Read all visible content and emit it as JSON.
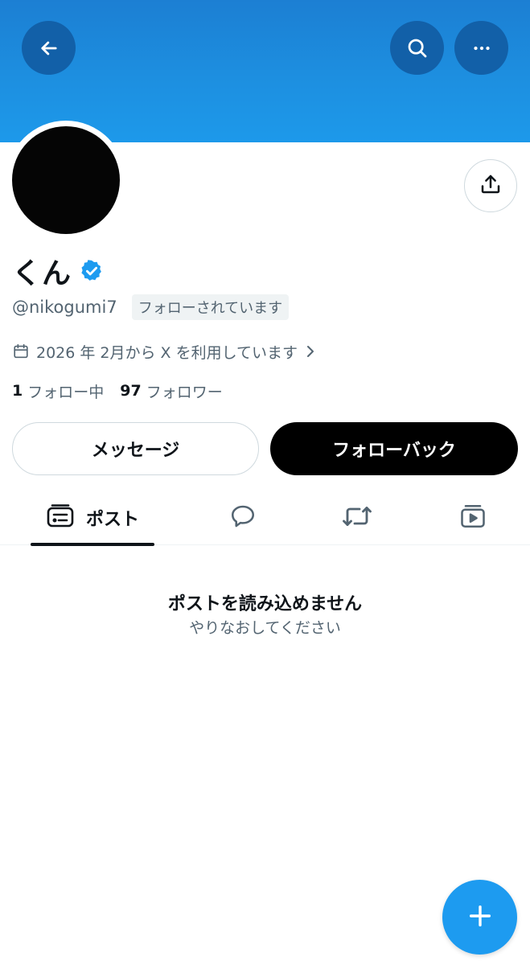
{
  "header": {
    "back_icon": "arrow-left-icon",
    "search_icon": "search-icon",
    "more_icon": "more-horizontal-icon",
    "banner_color": "#1d99ea"
  },
  "profile": {
    "name": "くん",
    "verified": true,
    "handle": "@nikogumi7",
    "follows_you_label": "フォローされています",
    "joined_text": "2026 年 2月から X を利用しています",
    "following_count": "1",
    "following_label": "フォロー中",
    "followers_count": "97",
    "followers_label": "フォロワー",
    "share_icon": "share-icon"
  },
  "actions": {
    "message_label": "メッセージ",
    "follow_back_label": "フォローバック"
  },
  "tabs": [
    {
      "id": "posts",
      "label": "ポスト",
      "icon": "posts-icon",
      "active": true
    },
    {
      "id": "replies",
      "label": "",
      "icon": "reply-icon",
      "active": false
    },
    {
      "id": "reposts",
      "label": "",
      "icon": "repost-icon",
      "active": false
    },
    {
      "id": "media",
      "label": "",
      "icon": "video-icon",
      "active": false
    }
  ],
  "empty_state": {
    "title": "ポストを読み込めません",
    "subtitle": "やりなおしてください"
  },
  "fab": {
    "icon": "plus-icon",
    "color": "#1d9bf0"
  },
  "colors": {
    "accent": "#1d9bf0",
    "text_primary": "#0f1419",
    "text_secondary": "#536471"
  }
}
